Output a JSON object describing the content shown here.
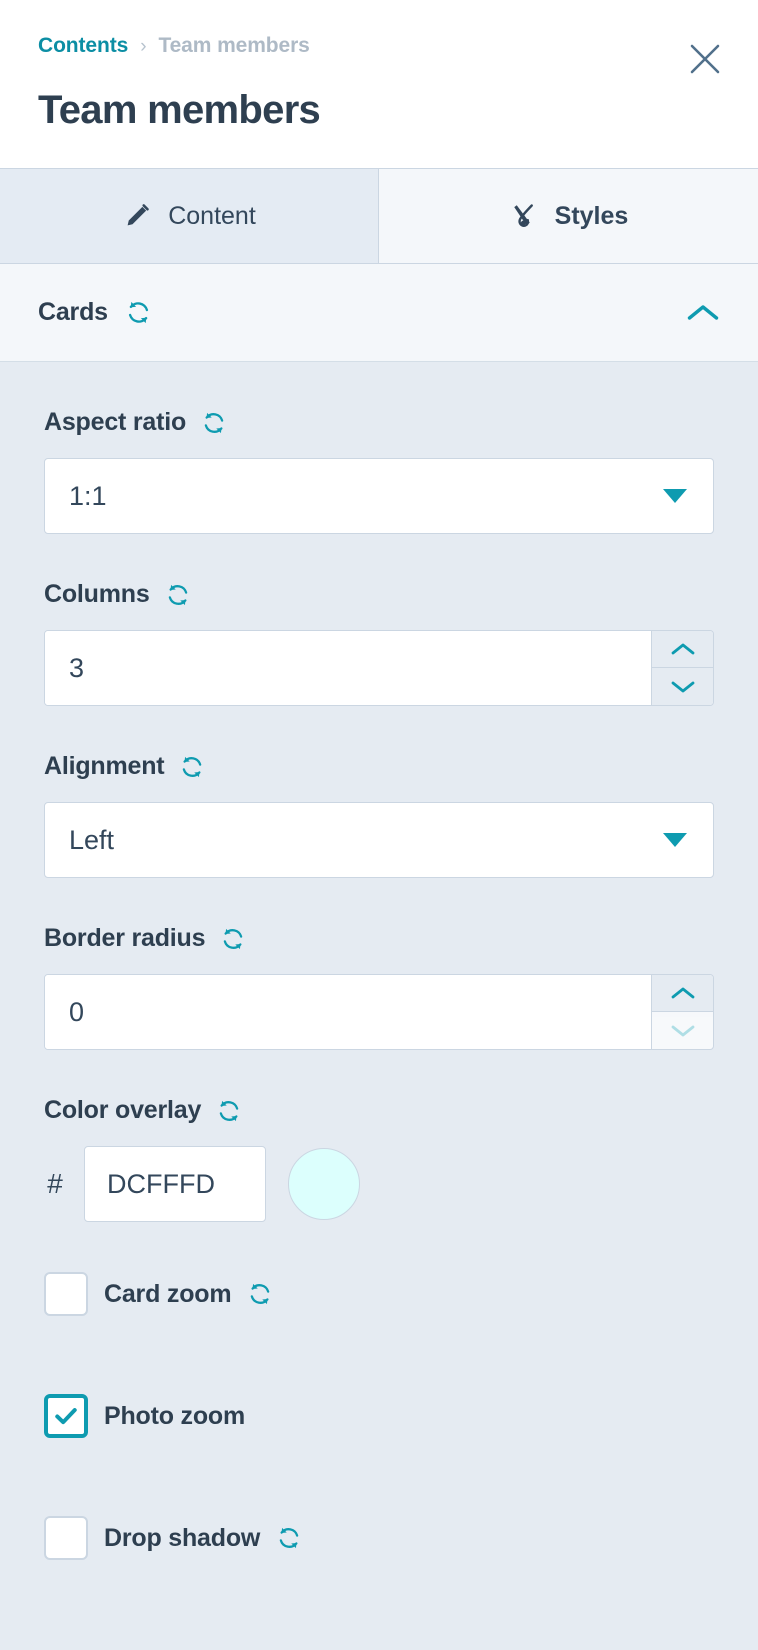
{
  "header": {
    "breadcrumb_root": "Contents",
    "breadcrumb_separator": "›",
    "breadcrumb_current": "Team members",
    "title": "Team members",
    "close_icon": "close-icon"
  },
  "tabs": [
    {
      "label": "Content",
      "icon": "pencil-icon",
      "active": true
    },
    {
      "label": "Styles",
      "icon": "paintbrush-icon",
      "active": false
    }
  ],
  "section": {
    "title": "Cards",
    "reset_icon": "reset-icon",
    "collapse_icon": "chevron-up-icon"
  },
  "fields": {
    "aspect_ratio": {
      "label": "Aspect ratio",
      "value": "1:1",
      "type": "select"
    },
    "columns": {
      "label": "Columns",
      "value": "3",
      "type": "number"
    },
    "alignment": {
      "label": "Alignment",
      "value": "Left",
      "type": "select"
    },
    "border_radius": {
      "label": "Border radius",
      "value": "0",
      "type": "number"
    },
    "color_overlay": {
      "label": "Color overlay",
      "hash": "#",
      "value": "DCFFFD",
      "swatch_color": "#DCFFFD"
    }
  },
  "checkboxes": [
    {
      "label": "Card zoom",
      "checked": false,
      "has_reset": true
    },
    {
      "label": "Photo zoom",
      "checked": true,
      "has_reset": false
    },
    {
      "label": "Drop shadow",
      "checked": false,
      "has_reset": true
    }
  ],
  "colors": {
    "accent": "#0E9BB0",
    "link": "#0C8EA4",
    "text": "#2E3F50",
    "muted": "#AEBAC6",
    "panel_bg": "#E5EBF2",
    "tab_bg": "#F4F7FA"
  }
}
